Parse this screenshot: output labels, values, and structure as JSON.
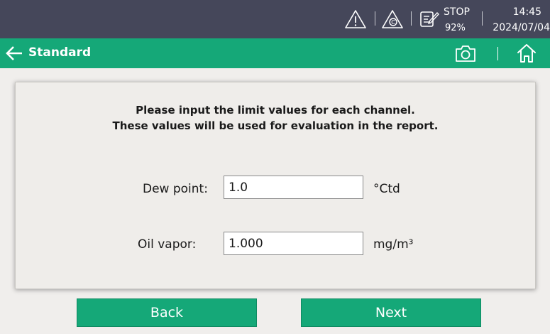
{
  "status": {
    "icons": [
      "warning-icon",
      "calibration-warning-icon",
      "report-icon"
    ],
    "recording_state": "STOP",
    "battery": "92%",
    "time": "14:45",
    "date": "2024/07/04"
  },
  "titlebar": {
    "title": "Standard",
    "icons": [
      "back-arrow-icon",
      "camera-icon",
      "home-icon"
    ]
  },
  "form": {
    "instruction_line1": "Please input the limit values for each channel.",
    "instruction_line2": "These values will be used for evaluation in the report.",
    "dew_point": {
      "label": "Dew point:",
      "value": "1.0",
      "unit": "°Ctd"
    },
    "oil_vapor": {
      "label": "Oil vapor:",
      "value": "1.000",
      "unit": "mg/m³"
    }
  },
  "buttons": {
    "back": "Back",
    "next": "Next"
  },
  "colors": {
    "status_bar": "#45475a",
    "accent": "#15a878",
    "background": "#f0eeec"
  }
}
